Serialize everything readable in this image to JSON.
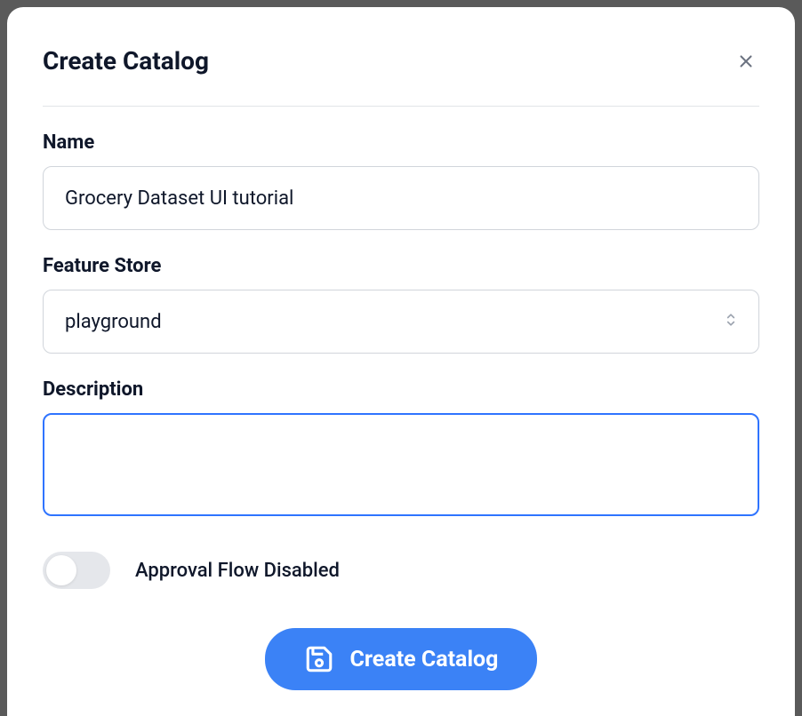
{
  "modal": {
    "title": "Create Catalog",
    "fields": {
      "name": {
        "label": "Name",
        "value": "Grocery Dataset UI tutorial"
      },
      "feature_store": {
        "label": "Feature Store",
        "value": "playground"
      },
      "description": {
        "label": "Description",
        "value": ""
      }
    },
    "toggle": {
      "label": "Approval Flow Disabled",
      "enabled": false
    },
    "submit": {
      "label": "Create Catalog"
    }
  }
}
